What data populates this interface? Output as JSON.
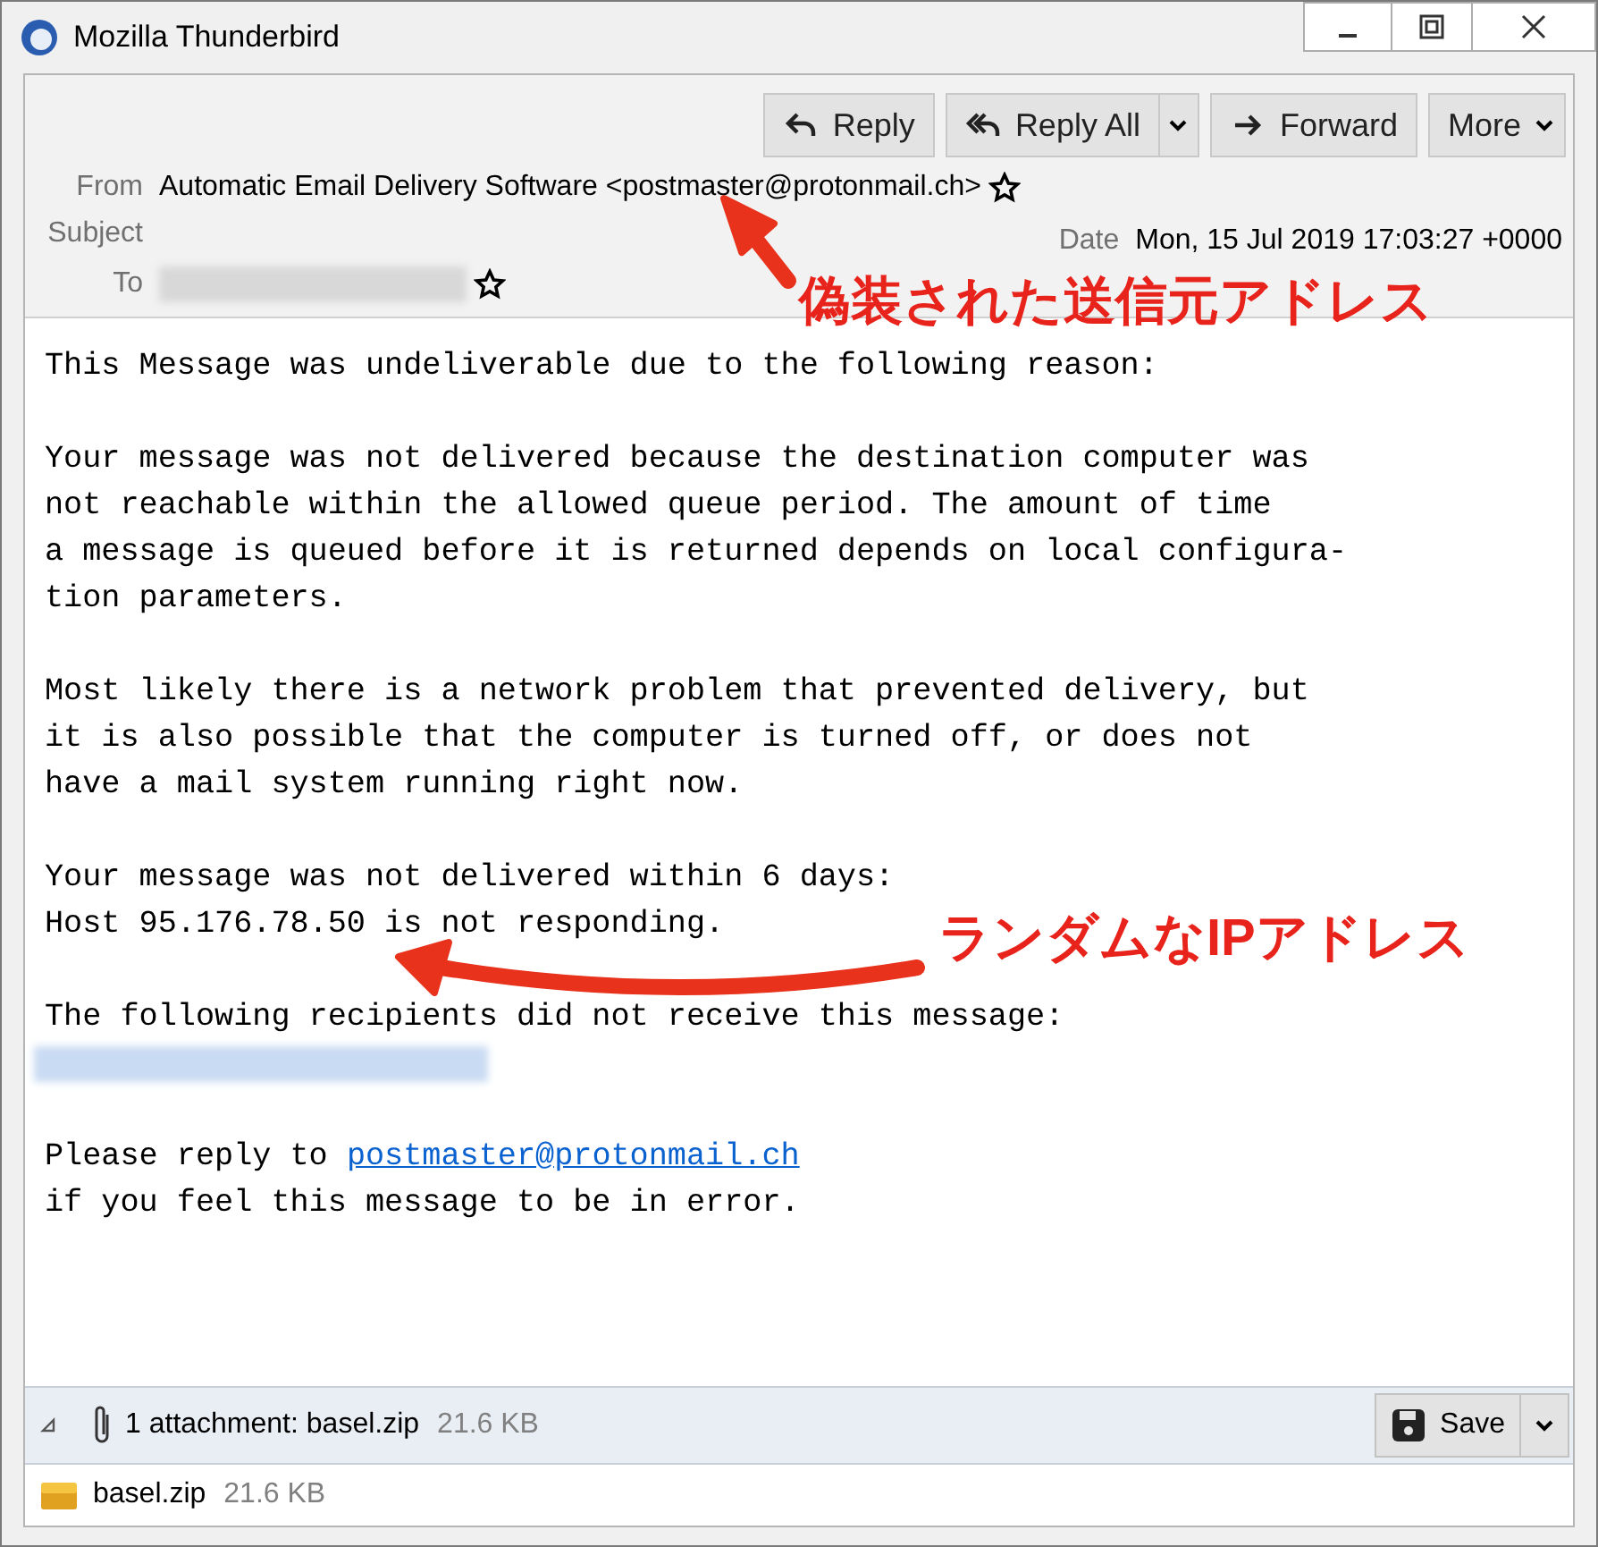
{
  "window": {
    "title": "Mozilla Thunderbird"
  },
  "toolbar": [
    {
      "label": "Reply",
      "dropdown": false
    },
    {
      "label": "Reply All",
      "dropdown": true
    },
    {
      "label": "Forward",
      "dropdown": false
    },
    {
      "label": "More",
      "dropdown": true
    }
  ],
  "header": {
    "from_label": "From",
    "from": "Automatic Email Delivery Software <postmaster@protonmail.ch>",
    "subject_label": "Subject",
    "date_label": "Date",
    "date": "Mon, 15 Jul 2019 17:03:27 +0000",
    "to_label": "To"
  },
  "body": [
    {
      "kind": "text",
      "text": "This Message was undeliverable due to the following reason:"
    },
    {
      "kind": "blank"
    },
    {
      "kind": "text",
      "text": "Your message was not delivered because the destination computer was"
    },
    {
      "kind": "text",
      "text": "not reachable within the allowed queue period. The amount of time"
    },
    {
      "kind": "text",
      "text": "a message is queued before it is returned depends on local configura-"
    },
    {
      "kind": "text",
      "text": "tion parameters."
    },
    {
      "kind": "blank"
    },
    {
      "kind": "text",
      "text": "Most likely there is a network problem that prevented delivery, but"
    },
    {
      "kind": "text",
      "text": "it is also possible that the computer is turned off, or does not"
    },
    {
      "kind": "text",
      "text": "have a mail system running right now."
    },
    {
      "kind": "blank"
    },
    {
      "kind": "text",
      "text": "Your message was not delivered within 6 days:"
    },
    {
      "kind": "text",
      "text": "Host 95.176.78.50 is not responding."
    },
    {
      "kind": "blank"
    },
    {
      "kind": "text",
      "text": "The following recipients did not receive this message:"
    },
    {
      "kind": "redacted"
    },
    {
      "kind": "blank"
    },
    {
      "kind": "link",
      "text": "Please reply to ",
      "link": "postmaster@protonmail.ch"
    },
    {
      "kind": "text",
      "text": "if you feel this message to be in error."
    }
  ],
  "attachment_bar": {
    "summary": "1 attachment: basel.zip",
    "size": "21.6 KB",
    "save": "Save"
  },
  "attachments": [
    {
      "name": "basel.zip",
      "size": "21.6 KB"
    }
  ],
  "annotations": [
    {
      "text": "偽装された送信元アドレス"
    },
    {
      "text": "ランダムなIPアドレス"
    }
  ]
}
